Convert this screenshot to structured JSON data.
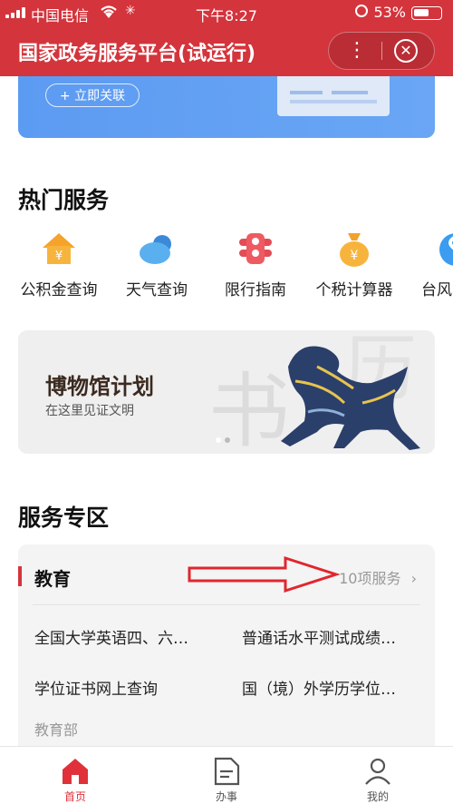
{
  "status_bar": {
    "carrier": "中国电信",
    "time": "下午8:27",
    "battery": "53%"
  },
  "title_bar": {
    "title": "国家政务服务平台(试运行)"
  },
  "banner": {
    "link_label": "+ 立即关联"
  },
  "hot_services": {
    "title": "热门服务",
    "items": [
      {
        "label": "公积金查询",
        "icon": "house-icon"
      },
      {
        "label": "天气查询",
        "icon": "cloud-icon"
      },
      {
        "label": "限行指南",
        "icon": "traffic-light-icon"
      },
      {
        "label": "个税计算器",
        "icon": "money-bag-icon"
      },
      {
        "label": "台风",
        "icon": "typhoon-icon"
      }
    ]
  },
  "museum": {
    "title": "博物馆计划",
    "subtitle": "在这里见证文明"
  },
  "service_zone": {
    "title": "服务专区",
    "category": "教育",
    "count_label": "10项服务",
    "items": [
      "全国大学英语四、六…",
      "普通话水平测试成绩…",
      "学位证书网上查询",
      "国（境）外学历学位…"
    ],
    "department": "教育部"
  },
  "tabs": [
    {
      "label": "首页",
      "icon": "home-icon",
      "active": true
    },
    {
      "label": "办事",
      "icon": "document-icon",
      "active": false
    },
    {
      "label": "我的",
      "icon": "user-icon",
      "active": false
    }
  ],
  "colors": {
    "brand_red": "#d4343c",
    "banner_blue": "#5c9bf2"
  }
}
